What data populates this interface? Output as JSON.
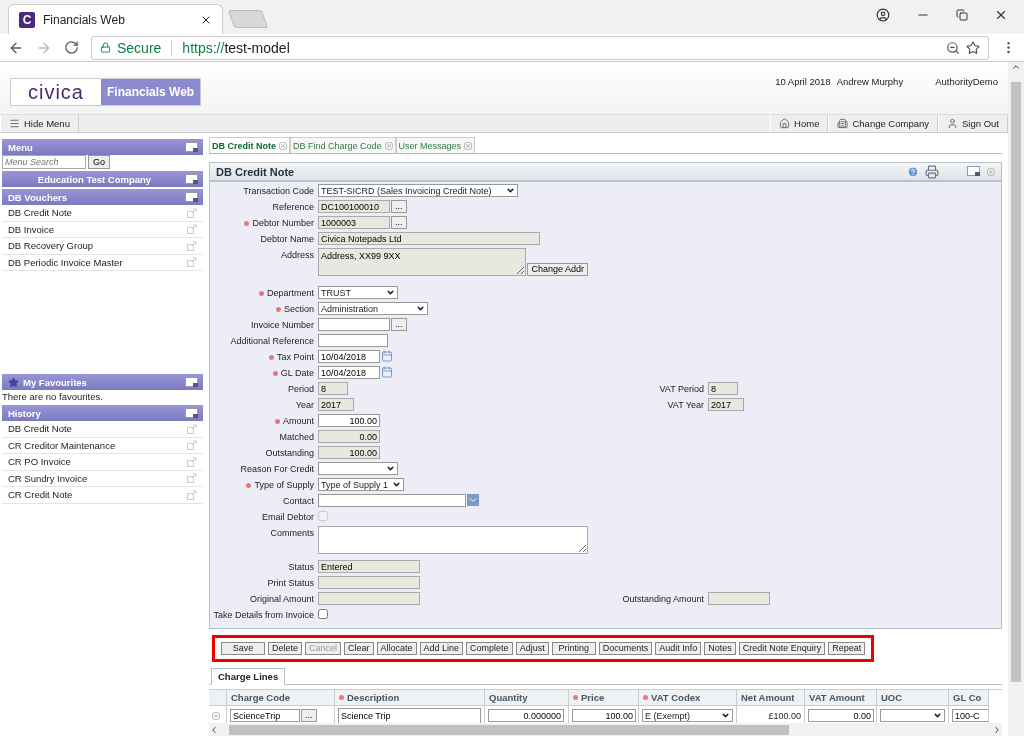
{
  "browser": {
    "tab_title": "Financials Web",
    "favicon_letter": "C",
    "secure_label": "Secure",
    "url_scheme": "https://",
    "url_host": "test-model"
  },
  "header": {
    "logo_brand": "civica",
    "logo_product": "Financials Web",
    "date": "10 April 2018",
    "user": "Andrew Murphy",
    "authority": "AuthorityDemo"
  },
  "nav": {
    "hide_menu": "Hide Menu",
    "links": [
      "Home",
      "Change Company",
      "Sign Out"
    ]
  },
  "sidebar": {
    "menu_title": "Menu",
    "search_placeholder": "Menu Search",
    "go_button": "Go",
    "company": "Education Test Company",
    "vouchers_title": "DB Vouchers",
    "vouchers": [
      "DB Credit Note",
      "DB Invoice",
      "DB Recovery Group",
      "DB Periodic Invoice Master"
    ],
    "favourites_title": "My Favourites",
    "favourites_empty": "There are no favourites.",
    "history_title": "History",
    "history": [
      "DB Credit Note",
      "CR Creditor Maintenance",
      "CR PO Invoice",
      "CR Sundry Invoice",
      "CR Credit Note"
    ]
  },
  "tabs": [
    {
      "label": "DB Credit Note",
      "selected": true
    },
    {
      "label": "DB Find Charge Code",
      "selected": false
    },
    {
      "label": "User Messages",
      "selected": false
    }
  ],
  "panel_title": "DB Credit Note",
  "fields": [
    {
      "label": "Transaction Code",
      "kind": "select",
      "required": false,
      "value": "TEST-SICRD (Sales Invoicing Credit Note)"
    },
    {
      "label": "Reference",
      "kind": "lookup",
      "required": false,
      "readonly": true,
      "value": "DC100100010",
      "button": "..."
    },
    {
      "label": "Debtor Number",
      "kind": "lookup",
      "required": true,
      "readonly": true,
      "value": "1000003",
      "button": "..."
    },
    {
      "label": "Debtor Name",
      "kind": "text",
      "required": false,
      "readonly": true,
      "value": "Civica Notepads Ltd"
    },
    {
      "label": "Address",
      "kind": "textarea",
      "required": false,
      "readonly": true,
      "value": "Address, XX99 9XX",
      "button": "Change Addr"
    },
    {
      "label": "Department",
      "kind": "select",
      "required": true,
      "value": "TRUST"
    },
    {
      "label": "Section",
      "kind": "select",
      "required": true,
      "value": "Administration"
    },
    {
      "label": "Invoice Number",
      "kind": "lookup",
      "required": false,
      "readonly": false,
      "button": "..."
    },
    {
      "label": "Additional Reference",
      "kind": "text",
      "required": false,
      "readonly": false
    },
    {
      "label": "Tax Point",
      "kind": "date",
      "required": true,
      "value": "10/04/2018"
    },
    {
      "label": "GL Date",
      "kind": "date",
      "required": true,
      "value": "10/04/2018"
    },
    {
      "label": "Period",
      "kind": "text",
      "required": false,
      "readonly": true,
      "value": "8",
      "side_label": "VAT Period",
      "side_value": "8"
    },
    {
      "label": "Year",
      "kind": "text",
      "required": false,
      "readonly": true,
      "value": "2017",
      "side_label": "VAT Year",
      "side_value": "2017"
    },
    {
      "label": "Amount",
      "kind": "number",
      "required": true,
      "readonly": false,
      "value": "100.00"
    },
    {
      "label": "Matched",
      "kind": "number",
      "required": false,
      "readonly": true,
      "value": "0.00"
    },
    {
      "label": "Outstanding",
      "kind": "number",
      "required": false,
      "readonly": true,
      "value": "100.00"
    },
    {
      "label": "Reason For Credit",
      "kind": "select",
      "required": false
    },
    {
      "label": "Type of Supply",
      "kind": "select",
      "required": true,
      "value": "Type of Supply 1"
    },
    {
      "label": "Contact",
      "kind": "combo",
      "required": false
    },
    {
      "label": "Email Debtor",
      "kind": "checkbox",
      "required": false,
      "checked": false,
      "disabled": true
    },
    {
      "label": "Comments",
      "kind": "textarea",
      "required": false,
      "readonly": false
    },
    {
      "label": "Status",
      "kind": "text",
      "required": false,
      "readonly": true,
      "value": "Entered"
    },
    {
      "label": "Print Status",
      "kind": "text",
      "required": false,
      "readonly": true
    },
    {
      "label": "Original Amount",
      "kind": "text",
      "required": false,
      "readonly": true,
      "side_label": "Outstanding Amount"
    },
    {
      "label": "Take Details from Invoice",
      "kind": "checkbox",
      "required": false,
      "checked": false,
      "disabled": false
    }
  ],
  "actions": {
    "highlighted": true,
    "buttons": [
      {
        "label": "Save",
        "disabled": false
      },
      {
        "label": "Delete",
        "disabled": false
      },
      {
        "label": "Cancel",
        "disabled": true
      },
      {
        "label": "Clear",
        "disabled": false
      },
      {
        "label": "Allocate",
        "disabled": false
      },
      {
        "label": "Add Line",
        "disabled": false
      },
      {
        "label": "Complete",
        "disabled": false
      },
      {
        "label": "Adjust",
        "disabled": false
      },
      {
        "label": "Printing",
        "disabled": false
      },
      {
        "label": "Documents",
        "disabled": false
      },
      {
        "label": "Audit Info",
        "disabled": false
      },
      {
        "label": "Notes",
        "disabled": false
      },
      {
        "label": "Credit Note Enquiry",
        "disabled": false
      },
      {
        "label": "Repeat",
        "disabled": false
      }
    ]
  },
  "charge_lines": {
    "tab": "Charge Lines",
    "columns": [
      {
        "label": "Charge Code",
        "required": false
      },
      {
        "label": "Description",
        "required": true
      },
      {
        "label": "Quantity",
        "required": false
      },
      {
        "label": "Price",
        "required": true
      },
      {
        "label": "VAT Codex",
        "required": true
      },
      {
        "label": "Net Amount",
        "required": false
      },
      {
        "label": "VAT Amount",
        "required": false
      },
      {
        "label": "UOC",
        "required": false
      },
      {
        "label": "GL Co",
        "required": false
      }
    ],
    "rows": [
      {
        "charge_code": "ScienceTrip",
        "lookup_button": "...",
        "description": "Science Trip",
        "quantity": "0.000000",
        "price": "100.00",
        "vat_codex": "E (Exempt)",
        "net_amount": "£100.00",
        "vat_amount": "0.00",
        "gl_code": "100-C"
      }
    ]
  }
}
